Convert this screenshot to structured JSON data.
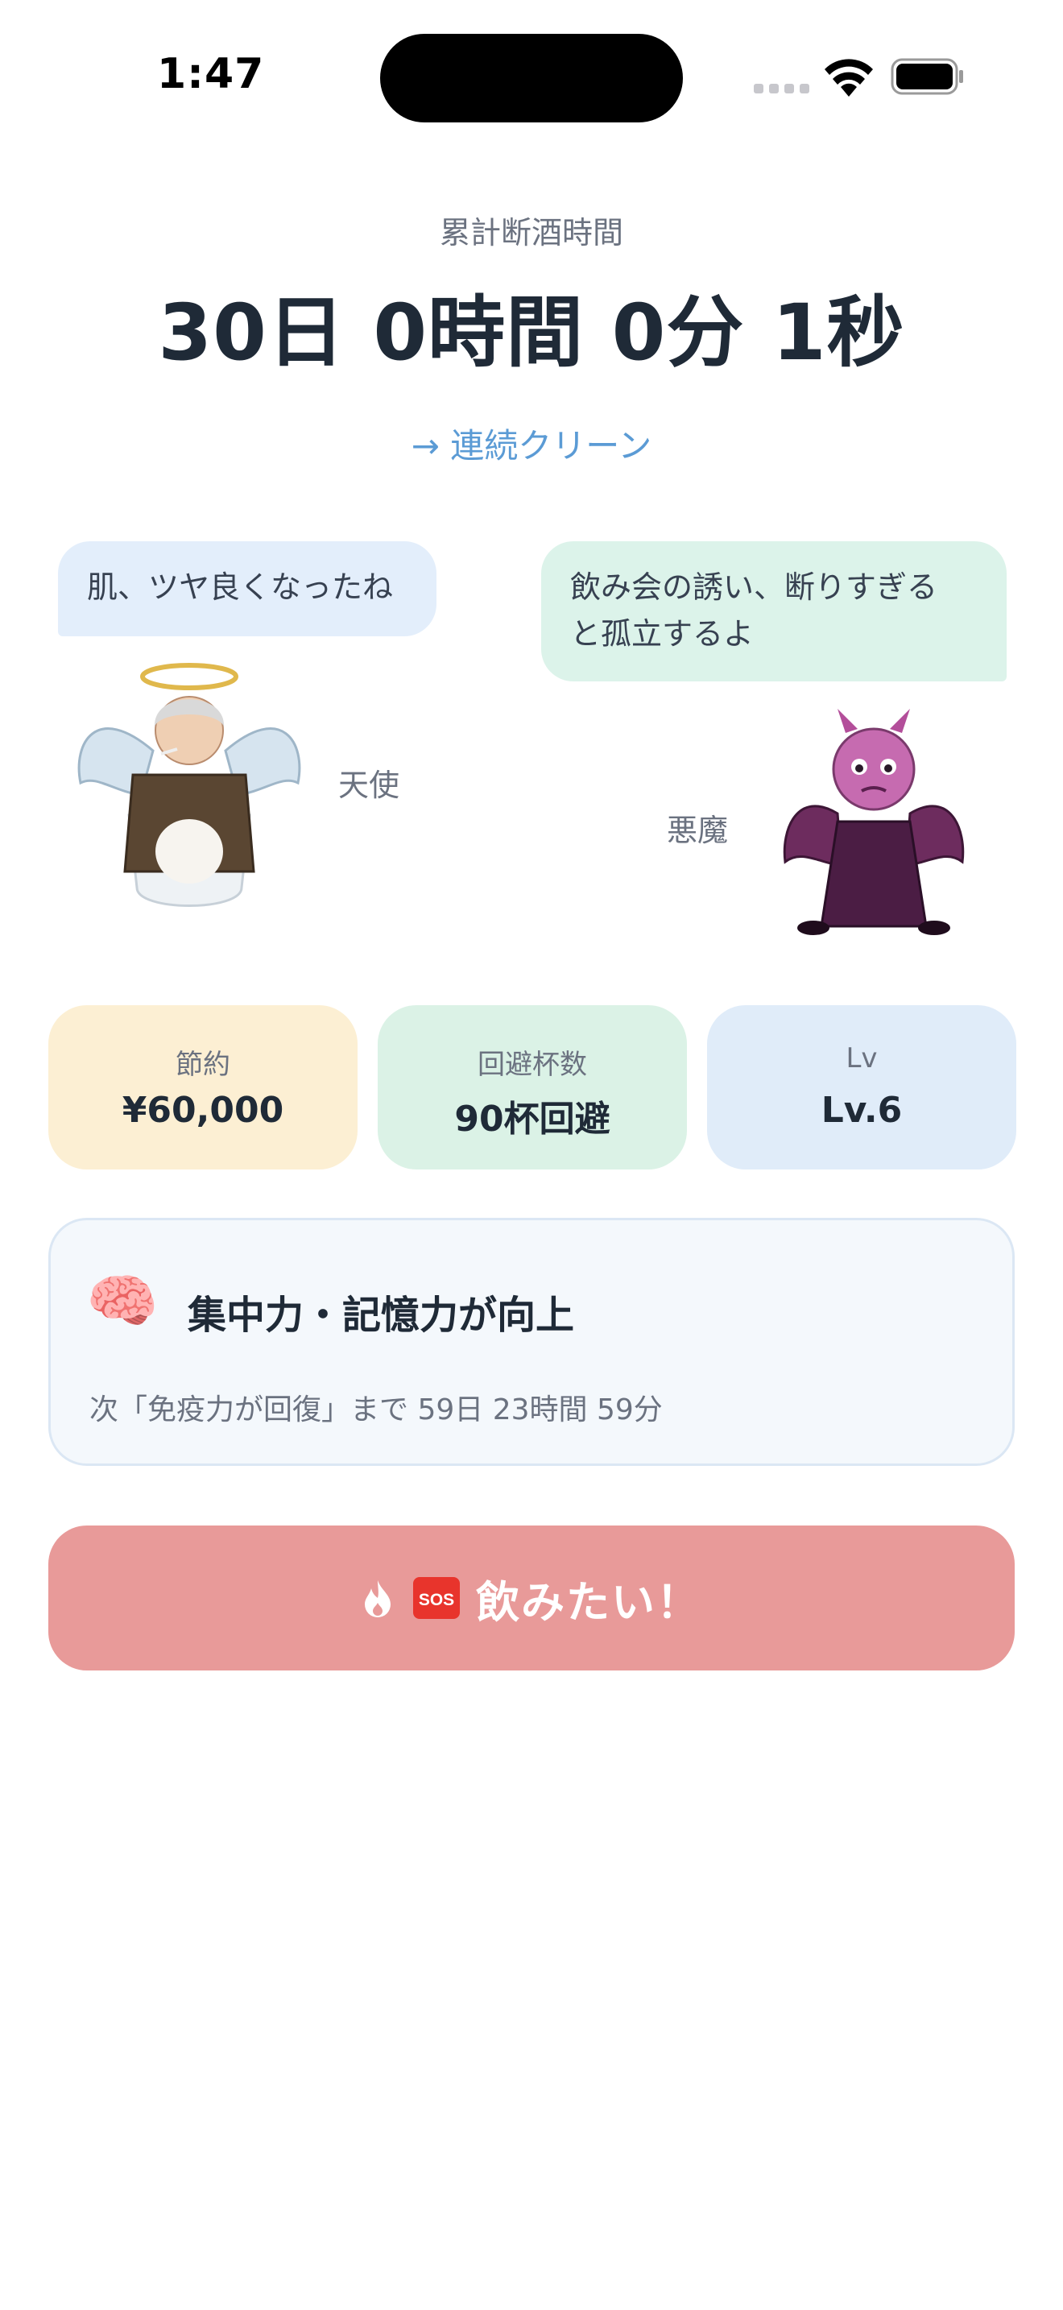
{
  "status_bar": {
    "time": "1:47"
  },
  "total": {
    "label": "累計断酒時間",
    "value": "30日 0時間 0分 1秒"
  },
  "streak_link": {
    "label": "→ 連続クリーン"
  },
  "angel": {
    "speech": "肌、ツヤ良くなったね",
    "label": "天使"
  },
  "devil": {
    "speech_line1": "飲み会の誘い、断りすぎる",
    "speech_line2": "と孤立するよ",
    "label": "悪魔"
  },
  "stats": {
    "saving": {
      "label": "節約",
      "value": "¥60,000"
    },
    "avoided": {
      "label": "回避杯数",
      "value": "90杯回避"
    },
    "level": {
      "label": "Lv",
      "value": "Lv.6"
    }
  },
  "benefit": {
    "icon": "brain-icon",
    "title": "集中力・記憶力が向上",
    "next": "次「免疫力が回復」まで 59日 23時間 59分"
  },
  "sos_button": {
    "label": "飲みたい！"
  },
  "colors": {
    "accent_link": "#5b9bd5",
    "sos": "#e89a99",
    "saving_card": "#fcefd3",
    "avoid_card": "#dbf2e6",
    "level_card": "#e0ecf9"
  }
}
